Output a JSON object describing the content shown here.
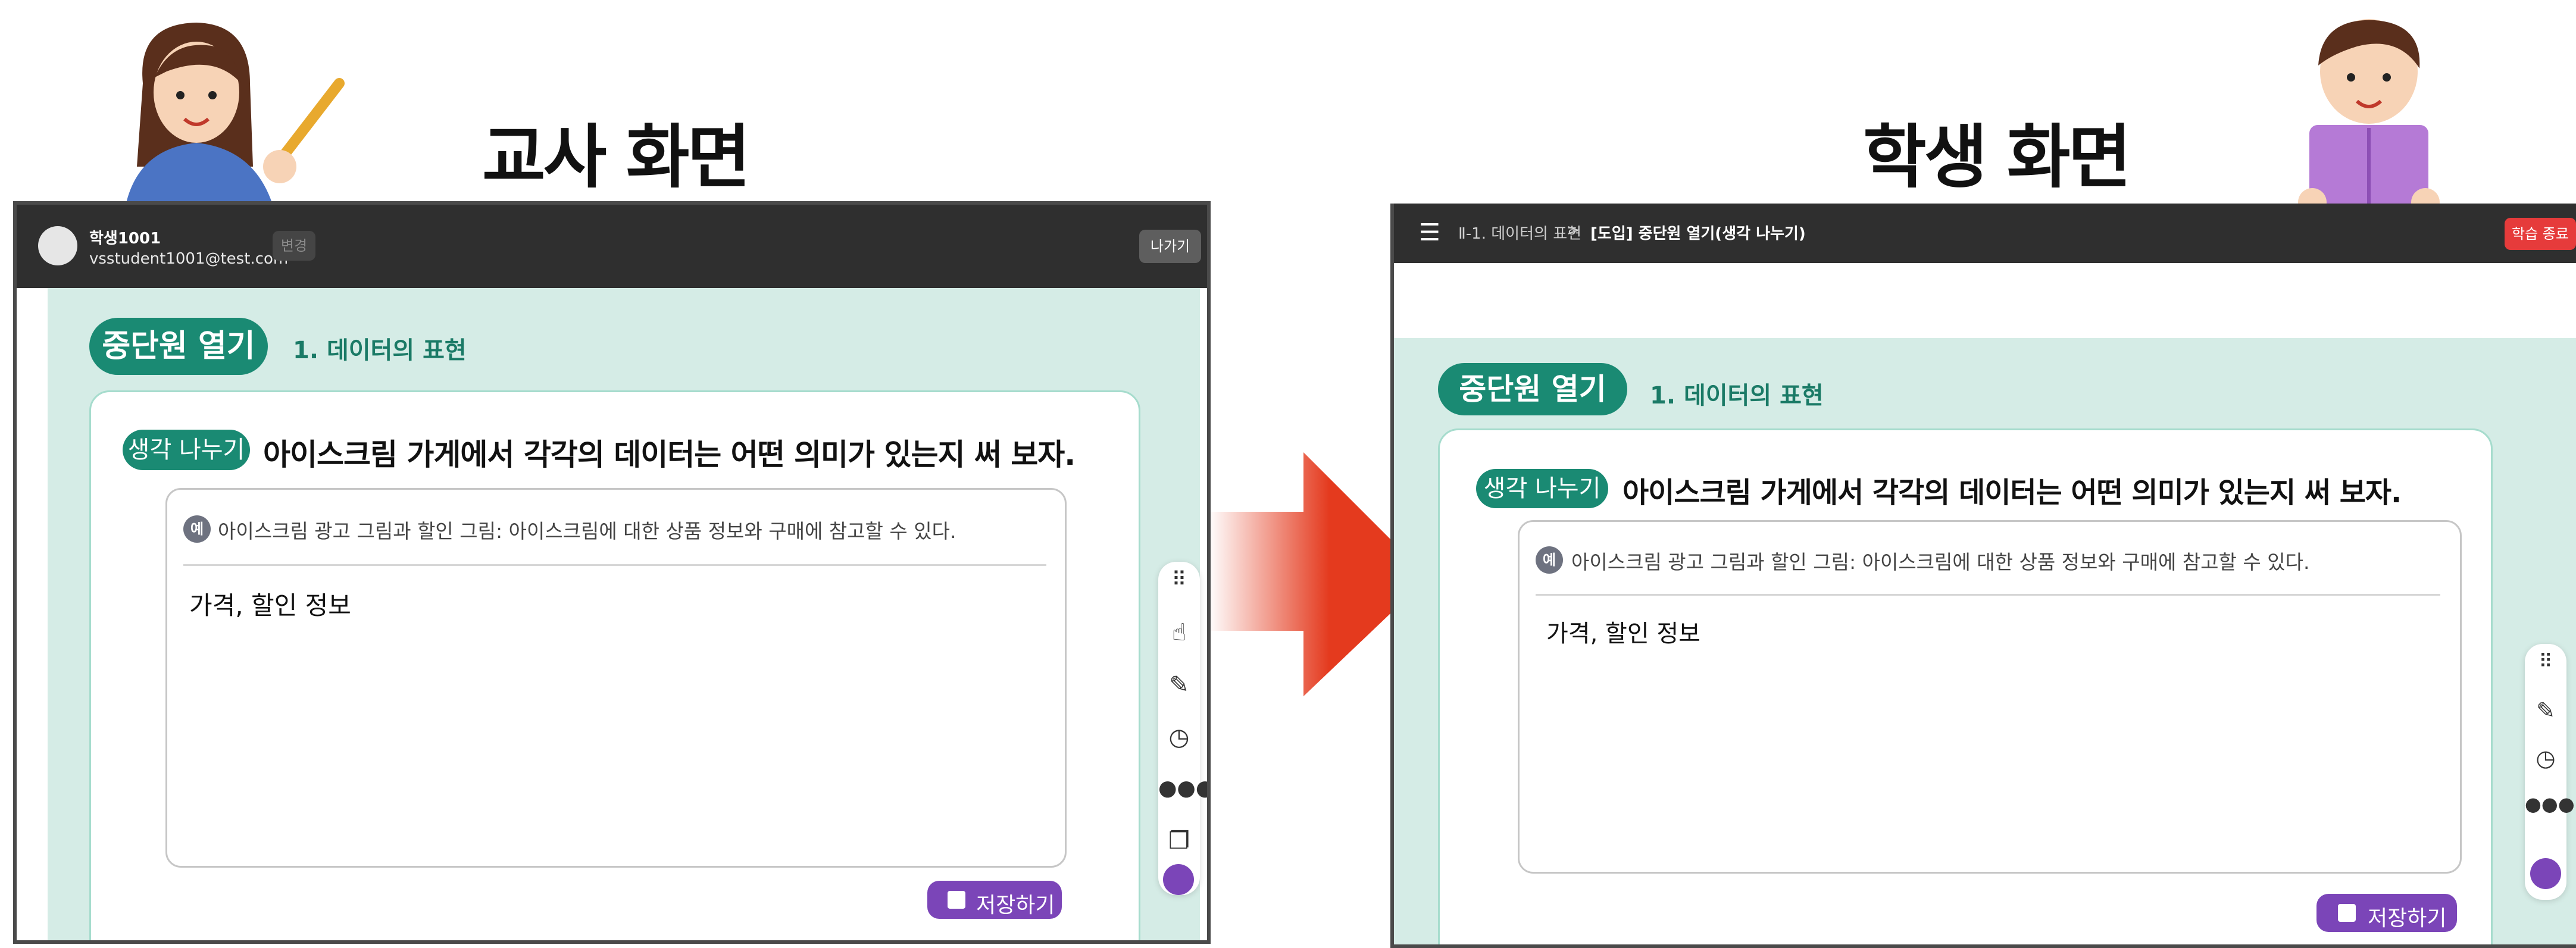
{
  "captions": {
    "teacher": "교사 화면",
    "student": "학생 화면"
  },
  "teacher": {
    "user_name": "학생1001",
    "user_email": "vsstudent1001@test.com",
    "change_label": "변경",
    "exit_label": "나가기",
    "unit_chip": "중단원 열기",
    "unit_title": "1. 데이터의 표현",
    "activity_tag": "생각 나누기",
    "question": "아이스크림 가게에서 각각의 데이터는 어떤 의미가 있는지 써 보자.",
    "example_badge": "예",
    "example_text": "아이스크림 광고 그림과 할인 그림: 아이스크림에 대한 상품 정보와 구매에 참고할 수 있다.",
    "answer": "가격, 할인 정보",
    "save_label": "저장하기"
  },
  "student": {
    "breadcrumb_parent": "Ⅱ-1. 데이터의 표현",
    "breadcrumb_sep": ">",
    "breadcrumb_current": "[도입] 중단원 열기(생각 나누기)",
    "end_label": "학습 종료",
    "unit_chip": "중단원 열기",
    "unit_title": "1. 데이터의 표현",
    "activity_tag": "생각 나누기",
    "question": "아이스크림 가게에서 각각의 데이터는 어떤 의미가 있는지 써 보자.",
    "example_badge": "예",
    "example_text": "아이스크림 광고 그림과 할인 그림: 아이스크림에 대한 상품 정보와 구매에 참고할 수 있다.",
    "answer": "가격, 할인 정보",
    "save_label": "저장하기"
  },
  "colors": {
    "topbar": "#2f2f2f",
    "mint": "#d5ece6",
    "primary_green": "#1a8a73",
    "save_purple": "#7b45b8",
    "end_red": "#e63b3b",
    "arrow_red": "#e43a1e"
  },
  "icons": {
    "teacher_tools": [
      "grip-dots-icon",
      "hand-pointer-icon",
      "pencil-icon",
      "timer-icon",
      "group-icon",
      "copy-icon",
      "chat-bubble-icon"
    ],
    "student_tools": [
      "grip-dots-icon",
      "pencil-icon",
      "timer-icon",
      "group-icon",
      "chat-bubble-icon"
    ]
  }
}
